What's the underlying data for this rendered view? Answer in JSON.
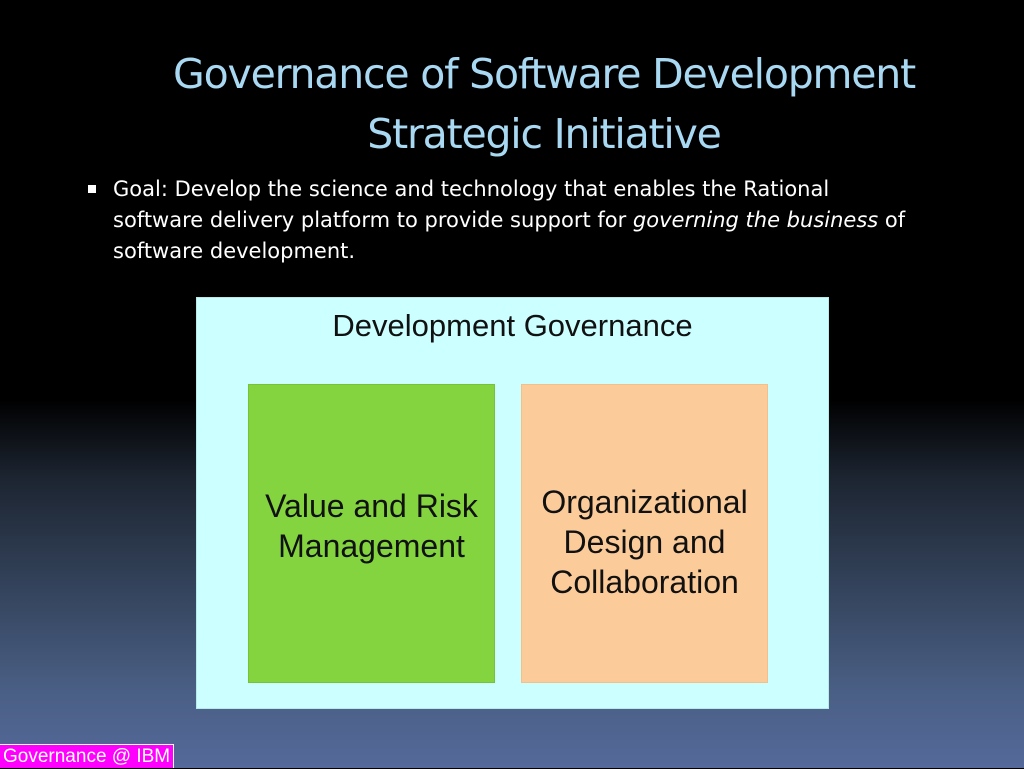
{
  "slide": {
    "title_line1": "Governance of Software Development",
    "title_line2": "Strategic Initiative",
    "bullet": {
      "prefix": "Goal: Develop the science and technology that enables the Rational software delivery platform to provide support for ",
      "emphasis": "governing the business",
      "suffix": " of software development."
    },
    "diagram": {
      "title": "Development Governance",
      "box_left": "Value and Risk Management",
      "box_right": "Organizational Design and Collaboration"
    },
    "footer_label": "Governance @ IBM"
  }
}
